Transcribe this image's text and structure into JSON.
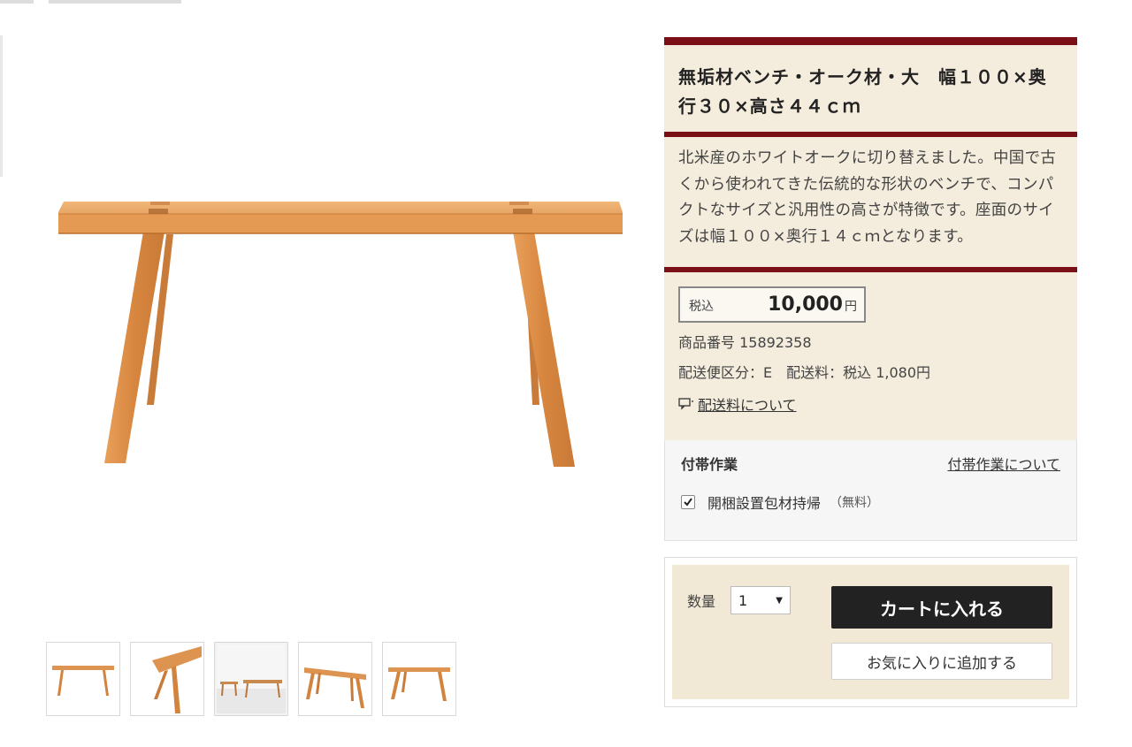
{
  "product": {
    "title": "無垢材ベンチ・オーク材・大　幅１００×奥行３０×高さ４４ｃｍ",
    "description": "北米産のホワイトオークに切り替えました。中国で古くから使われてきた伝統的な形状のベンチで、コンパクトなサイズと汎用性の高さが特徴です。座面のサイズは幅１００×奥行１４ｃｍとなります。",
    "image_icon": "wooden-bench-image"
  },
  "price": {
    "tax_label": "税込",
    "value": "10,000",
    "unit": "円"
  },
  "info": {
    "product_number": "商品番号 15892358",
    "shipping_class": "配送便区分：E　配送料：税込 1,080円",
    "shipping_link": "配送料について",
    "shipping_link_icon": "speech-bubble-icon"
  },
  "options": {
    "title": "付帯作業",
    "link": "付帯作業について",
    "items": [
      {
        "label": "開梱設置包材持帰",
        "note": "（無料）",
        "checked": true
      }
    ]
  },
  "cart": {
    "qty_label": "数量",
    "qty_value": "1",
    "add_to_cart": "カートに入れる",
    "add_to_favorites": "お気に入りに追加する"
  },
  "thumbnails": [
    "bench-front-thumb",
    "bench-angle-thumb",
    "bench-room-thumb",
    "bench-perspective-thumb",
    "bench-side-thumb"
  ],
  "colors": {
    "accent": "#7a0f18",
    "panel_bg": "#f4ecdc",
    "wood": "#d98f4c",
    "button": "#222222"
  }
}
